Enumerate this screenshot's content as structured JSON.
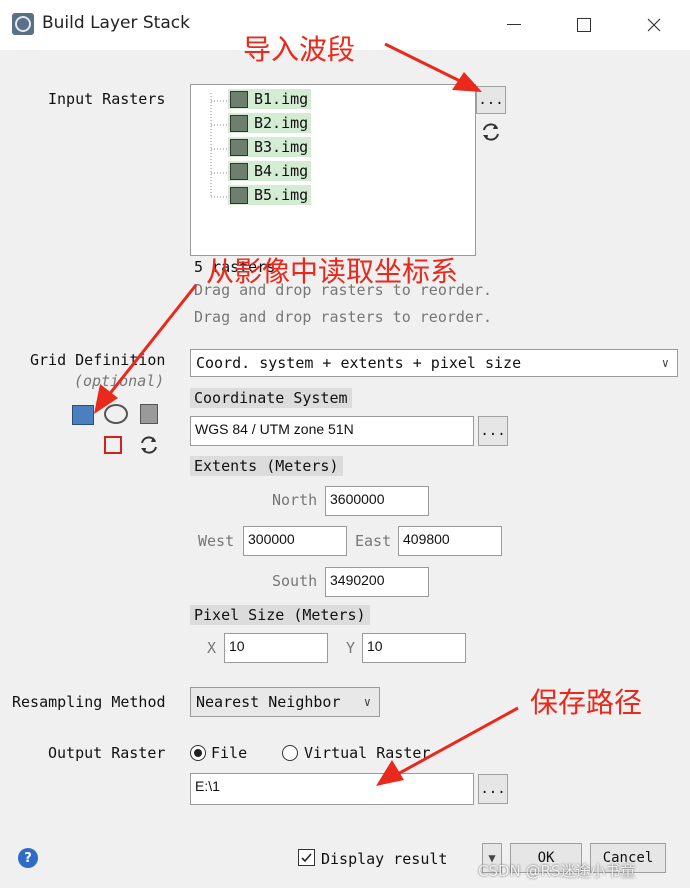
{
  "window": {
    "title": "Build Layer Stack"
  },
  "input_rasters": {
    "label": "Input Rasters",
    "items": [
      "B1.img",
      "B2.img",
      "B3.img",
      "B4.img",
      "B5.img"
    ],
    "count_text": "5 rasters",
    "hint_1": "Drag and drop rasters to reorder.",
    "hint_2": "Drag and drop rasters to reorder.",
    "browse_label": "..."
  },
  "grid_definition": {
    "label": "Grid Definition",
    "optional_label": "(optional)",
    "mode_value": "Coord. system + extents + pixel size",
    "coord_system_header": "Coordinate System",
    "coord_system_value": "WGS 84 / UTM zone 51N",
    "extents_header": "Extents (Meters)",
    "north_label": "North",
    "north_value": "3600000",
    "west_label": "West",
    "west_value": "300000",
    "east_label": "East",
    "east_value": "409800",
    "south_label": "South",
    "south_value": "3490200",
    "pixel_size_header": "Pixel Size (Meters)",
    "x_label": "X",
    "x_value": "10",
    "y_label": "Y",
    "y_value": "10"
  },
  "resampling": {
    "label": "Resampling Method",
    "value": "Nearest Neighbor"
  },
  "output": {
    "label": "Output Raster",
    "file_label": "File",
    "virtual_label": "Virtual Raster",
    "path_value": "E:\\1",
    "file_selected": true
  },
  "footer": {
    "display_result_label": "Display result",
    "display_result_checked": true,
    "ok_label": "OK",
    "cancel_label": "Cancel"
  },
  "annotations": {
    "import_bands": "导入波段",
    "read_coords": "从影像中读取坐标系",
    "save_path": "保存路径",
    "watermark": "CSDN @RS迷途小书童"
  },
  "colors": {
    "annotation_red": "#e8291c",
    "tree_highlight": "#d3ecd3"
  }
}
